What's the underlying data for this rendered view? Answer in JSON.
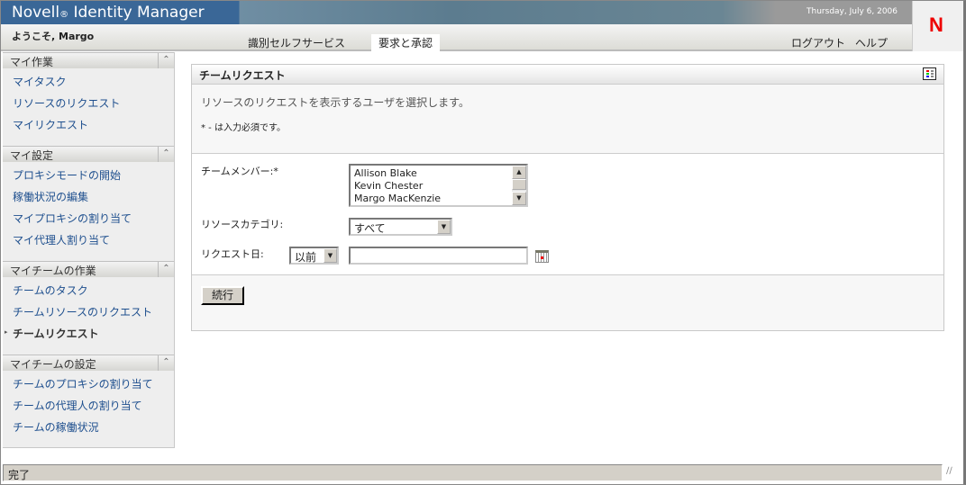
{
  "header": {
    "product": "Novell",
    "reg": "®",
    "product_name": "Identity Manager",
    "date": "Thursday, July 6, 2006",
    "logo": "N"
  },
  "nav": {
    "welcome": "ようこそ, Margo",
    "tabs": [
      {
        "label": "識別セルフサービス"
      },
      {
        "label": "要求と承認",
        "active": true
      }
    ],
    "logout": "ログアウト",
    "help": "ヘルプ"
  },
  "sidebar": {
    "sections": [
      {
        "title": "マイ作業",
        "items": [
          "マイタスク",
          "リソースのリクエスト",
          "マイリクエスト"
        ]
      },
      {
        "title": "マイ設定",
        "items": [
          "プロキシモードの開始",
          "稼働状況の編集",
          "マイプロキシの割り当て",
          "マイ代理人割り当て"
        ]
      },
      {
        "title": "マイチームの作業",
        "items": [
          "チームのタスク",
          "チームリソースのリクエスト",
          "チームリクエスト"
        ],
        "current": "チームリクエスト"
      },
      {
        "title": "マイチームの設定",
        "items": [
          "チームのプロキシの割り当て",
          "チームの代理人の割り当て",
          "チームの稼働状況"
        ]
      }
    ],
    "collapse_icon": "double-chevron-up"
  },
  "panel": {
    "title": "チームリクエスト",
    "description": "リソースのリクエストを表示するユーザを選択します。",
    "required_note": "* - は入力必須です。",
    "team_member_label": "チームメンバー:*",
    "team_members": [
      "Allison Blake",
      "Kevin Chester",
      "Margo MacKenzie"
    ],
    "category_label": "リソースカテゴリ:",
    "category_value": "すべて",
    "date_label": "リクエスト日:",
    "date_op": "以前",
    "date_value": "",
    "continue": "続行"
  },
  "status": {
    "text": "完了"
  }
}
